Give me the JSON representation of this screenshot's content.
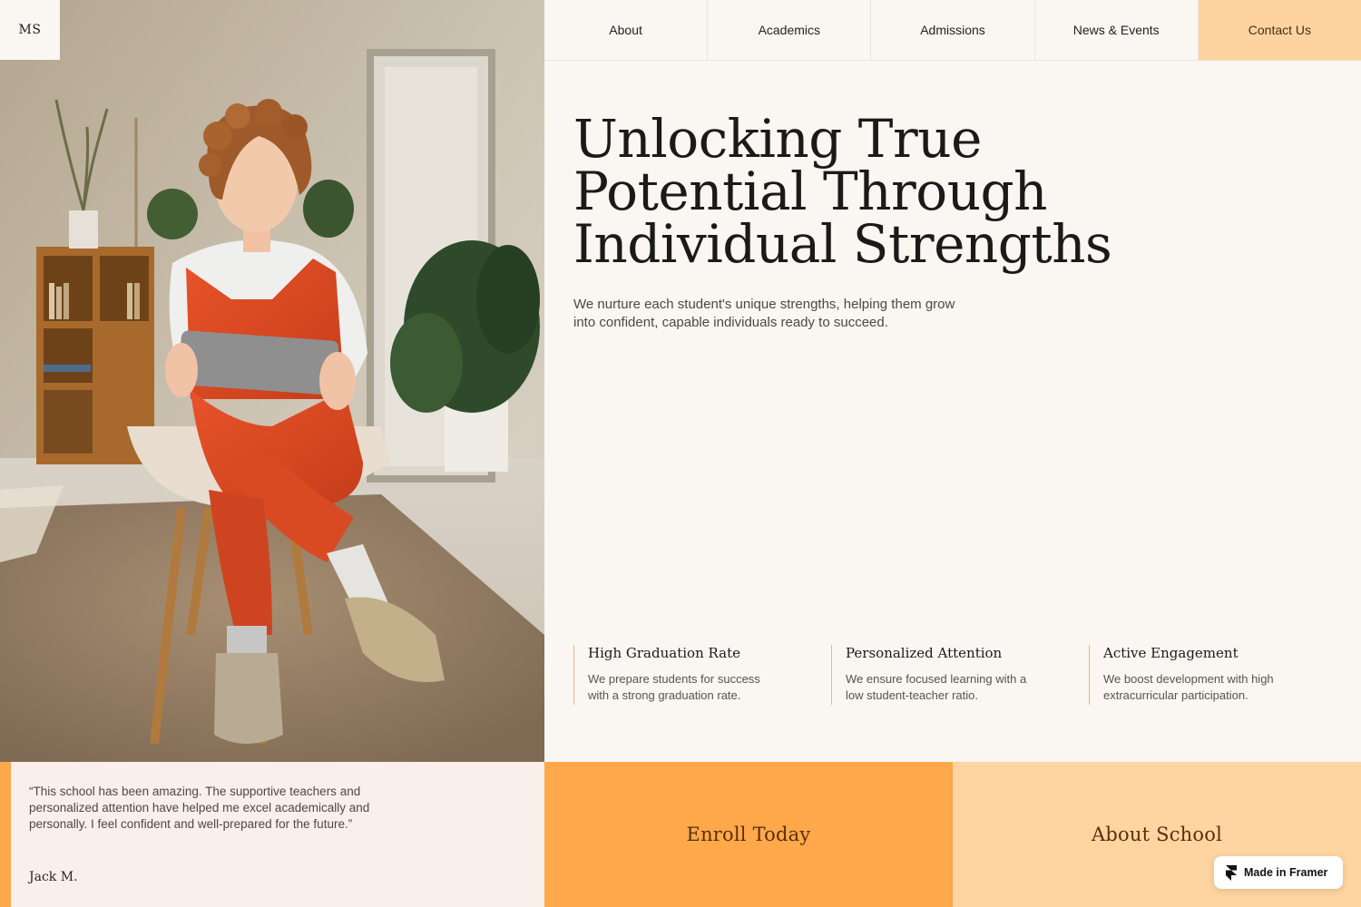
{
  "logo": {
    "text": "MS"
  },
  "nav": {
    "items": [
      {
        "label": "About"
      },
      {
        "label": "Academics"
      },
      {
        "label": "Admissions"
      },
      {
        "label": "News & Events"
      }
    ],
    "cta_label": "Contact Us"
  },
  "hero": {
    "title_lines": [
      "Unlocking True",
      "Potential Through",
      "Individual Strengths"
    ],
    "subtitle": "We nurture each student's unique strengths, helping them grow into confident, capable individuals ready to succeed."
  },
  "features": [
    {
      "title": "High Graduation Rate",
      "text": "We prepare students for success with a strong graduation rate."
    },
    {
      "title": "Personalized Attention",
      "text": "We ensure focused learning with a low student-teacher ratio."
    },
    {
      "title": "Active Engagement",
      "text": "We boost development with high extracurricular participation."
    }
  ],
  "testimonial": {
    "quote": "“This school has been amazing. The supportive teachers and personalized attention have helped me excel academically and personally. I feel confident and well-prepared for the future.”",
    "author": "Jack M."
  },
  "cta_blocks": {
    "enroll": "Enroll Today",
    "about": "About School"
  },
  "badge": {
    "label": "Made in Framer",
    "icon": "framer-icon"
  },
  "colors": {
    "background": "#faf6f2",
    "accent_orange": "#ffa94a",
    "accent_peach": "#fed4a0",
    "testimonial_bg": "#faefea",
    "feature_rule": "#f3b46d"
  }
}
